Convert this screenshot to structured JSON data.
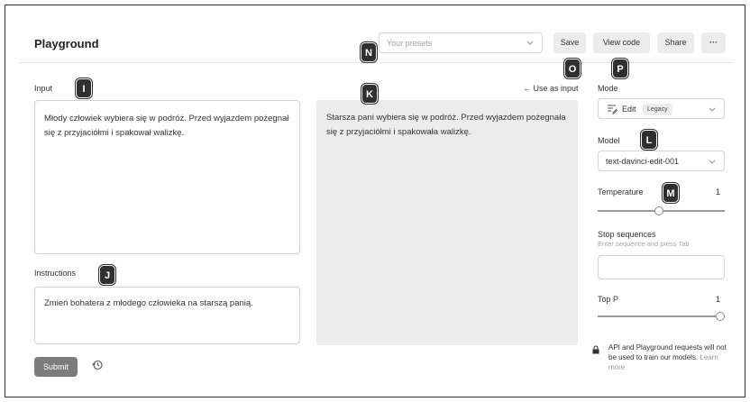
{
  "header": {
    "title": "Playground",
    "presets_placeholder": "Your presets",
    "save_label": "Save",
    "view_code_label": "View code",
    "share_label": "Share",
    "more_label": "···"
  },
  "input": {
    "label": "Input",
    "text": "Młody człowiek wybiera się w podróż.  Przed wyjazdem pożegnał się z przyjaciółmi i spakował walizkę."
  },
  "instructions": {
    "label": "Instructions",
    "text": "Zmień bohatera z młodego człowieka na starszą panią."
  },
  "output": {
    "use_as_input_label": "← Use as input",
    "text": "Starsza pani wybiera się w podróż.  Przed wyjazdem pożegnała się z przyjaciółmi i spakowała walizkę."
  },
  "actions": {
    "submit_label": "Submit"
  },
  "settings": {
    "mode_label": "Mode",
    "mode_value": "Edit",
    "mode_badge": "Legacy",
    "model_label": "Model",
    "model_value": "text-davinci-edit-001",
    "temperature_label": "Temperature",
    "temperature_value": "1",
    "temperature_fraction": 0.5,
    "stop_label": "Stop sequences",
    "stop_help": "Enter sequence and press Tab",
    "top_p_label": "Top P",
    "top_p_value": "1",
    "top_p_fraction": 1.0,
    "notice_text": "API and Playground requests will not be used to train our models.",
    "notice_link": "Learn more"
  },
  "markers": {
    "i": "I",
    "j": "J",
    "k": "K",
    "l": "L",
    "m": "M",
    "n": "N",
    "o": "O",
    "p": "P"
  },
  "colors": {
    "submit_bg": "#7c7c7c",
    "output_bg": "#ececec",
    "marker_bg": "#2f2f2f"
  }
}
